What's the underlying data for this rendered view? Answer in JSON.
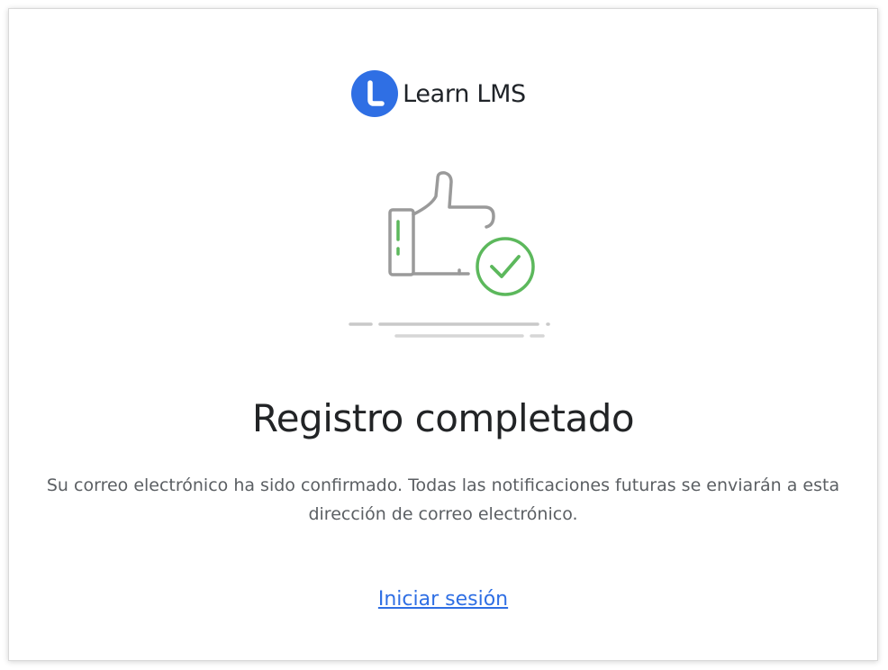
{
  "brand": {
    "name": "Learn LMS",
    "logo_icon": "learn-lms-logo-icon",
    "logo_color": "#2f6fe4"
  },
  "illustration": {
    "icon": "thumbs-up-check-icon",
    "check_color": "#5cb85c",
    "stroke_color": "#9a9a9a"
  },
  "content": {
    "title": "Registro completado",
    "message": "Su correo electrónico ha sido confirmado. Todas las notificaciones futuras se enviarán a esta dirección de correo electrónico.",
    "login_link": "Iniciar sesión"
  },
  "colors": {
    "link": "#2f6fe4",
    "title": "#222426",
    "body_text": "#5b5f63"
  }
}
